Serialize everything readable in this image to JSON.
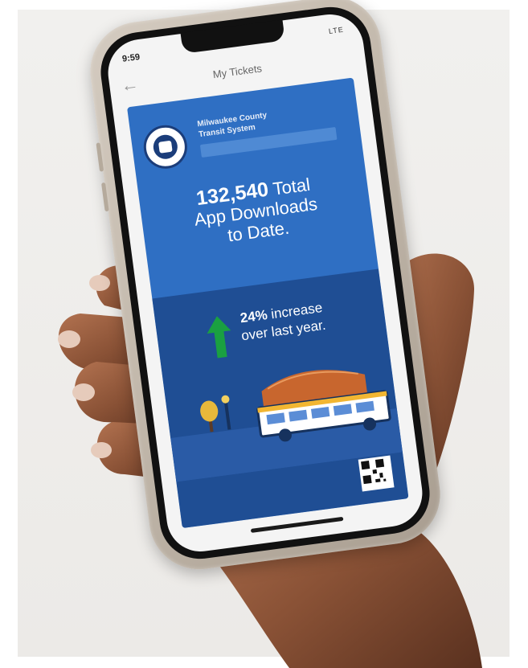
{
  "status": {
    "time": "9:59",
    "signal": "LTE"
  },
  "screen": {
    "title": "My Tickets"
  },
  "agency": {
    "name_line1": "Milwaukee County",
    "name_line2": "Transit System"
  },
  "downloads": {
    "number": "132,540",
    "text_line1": "Total",
    "text_line2": "App Downloads",
    "text_line3": "to Date."
  },
  "growth": {
    "number": "24%",
    "text_line1": "increase",
    "text_line2": "over last year."
  },
  "colors": {
    "card_blue": "#2f6fc3",
    "card_dark": "#1f4e94",
    "arrow_green": "#1aa041",
    "bus_yellow": "#f2b632",
    "arena_orange": "#c8662e"
  },
  "icons": [
    "back-arrow-icon",
    "county-seal-icon",
    "green-up-arrow-icon",
    "qr-code-icon"
  ]
}
